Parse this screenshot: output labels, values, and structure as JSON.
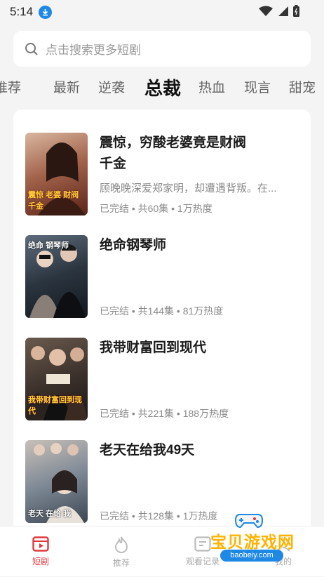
{
  "status": {
    "time": "5:14"
  },
  "search": {
    "placeholder": "点击搜索更多短剧"
  },
  "tabs": [
    {
      "label": "推荐"
    },
    {
      "label": "最新"
    },
    {
      "label": "逆袭"
    },
    {
      "label": "总裁"
    },
    {
      "label": "热血"
    },
    {
      "label": "现言"
    },
    {
      "label": "甜宠"
    }
  ],
  "dramas": [
    {
      "title": "震惊，穷酸老婆竟是财阀千金",
      "description": "顾晚晚深爱郑家明，却遭遇背叛。在...",
      "meta": "已完结 • 共60集 • 1万热度",
      "poster_caption": "震惊 老婆 财阀千金",
      "poster_colors": [
        "#7a3b2e",
        "#d9b7a0"
      ]
    },
    {
      "title": "绝命钢琴师",
      "description": "",
      "meta": "已完结 • 共144集 • 81万热度",
      "poster_caption": "绝命 钢琴师",
      "poster_colors": [
        "#1b2430",
        "#5e6c7c"
      ]
    },
    {
      "title": "我带财富回到现代",
      "description": "",
      "meta": "已完结 • 共221集 • 188万热度",
      "poster_caption": "我带财富回到现代",
      "poster_colors": [
        "#2b2420",
        "#6a5a4e"
      ]
    },
    {
      "title": "老天在给我49天",
      "description": "",
      "meta": "已完结 • 共128集 • 1万热度",
      "poster_caption": "老天 在给 我",
      "poster_colors": [
        "#5a6a7a",
        "#c8c0b8"
      ]
    }
  ],
  "bottom_nav": [
    {
      "label": "短剧",
      "icon": "video-icon"
    },
    {
      "label": "推荐",
      "icon": "flame-icon"
    },
    {
      "label": "观看记录",
      "icon": "history-icon"
    },
    {
      "label": "我的",
      "icon": "profile-icon"
    }
  ],
  "watermark": {
    "title": "宝贝游戏网",
    "url": "baobeiy.com"
  },
  "colors": {
    "accent": "#e0383e",
    "background": "#f4f4f4",
    "card": "#ffffff"
  }
}
